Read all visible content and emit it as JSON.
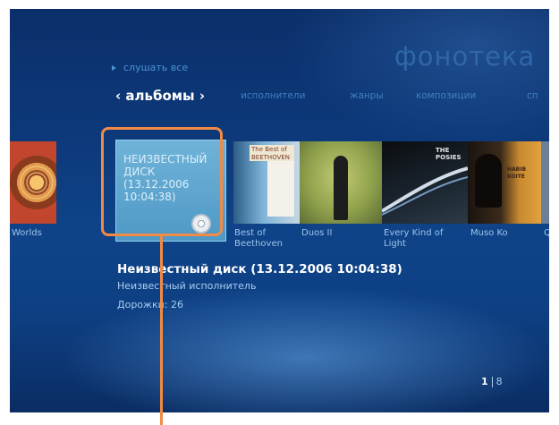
{
  "header": {
    "section_title": "фонотека",
    "play_all": "слушать все"
  },
  "tabs": {
    "active": "‹ альбомы ›",
    "items": [
      "исполнители",
      "жанры",
      "композиции",
      "сп"
    ]
  },
  "albums": [
    {
      "title": "Worlds"
    },
    {
      "title": "Неизвестный диск (13.12.2006 10:04:38)",
      "cover_text": "НЕИЗВЕСТНЫЙ ДИСК (13.12.2006 10:04:38)"
    },
    {
      "title": "The Best of Beethoven",
      "caption": "Best of Beethoven",
      "cover_text": "The Best of BEETHOVEN"
    },
    {
      "title": "Duos II"
    },
    {
      "title": "Every Kind of Light",
      "cover_text": "THE POSIES"
    },
    {
      "title": "Muso Ko",
      "cover_text": "HABIB KOITE"
    },
    {
      "title": "Q"
    }
  ],
  "details": {
    "title": "Неизвестный диск (13.12.2006 10:04:38)",
    "artist": "Неизвестный исполнитель",
    "tracks": "Дорожки: 26"
  },
  "pager": {
    "current": "1",
    "total": "8"
  },
  "colors": {
    "accent_highlight": "#f08a44",
    "background_dark": "#0b2f6a",
    "text_secondary": "#a9cdf0"
  }
}
